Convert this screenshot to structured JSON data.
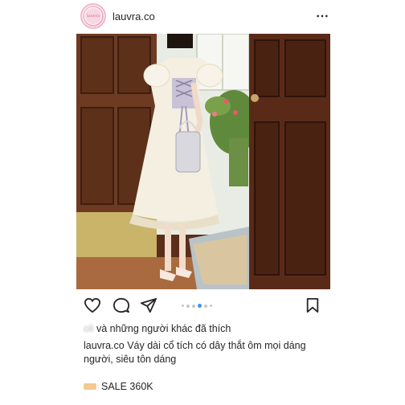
{
  "post": {
    "username": "lauvra.co",
    "avatar_text": "lauvra",
    "more_icon": "⋯",
    "likes": {
      "prefix_blurred": "oli     ",
      "text": "và những người khác đã thích"
    },
    "caption": {
      "username": "lauvra.co",
      "text": "Váy dài cổ tích có dây thắt ôm mọi dáng người, siêu tôn dáng"
    },
    "sale": "SALE 360K",
    "carousel": {
      "count": 6,
      "active_index": 3
    }
  },
  "colors": {
    "active_dot": "#3897f0",
    "inactive_dot": "#c7c7c7",
    "text": "#262626"
  },
  "icons": [
    "heart-icon",
    "comment-icon",
    "share-icon",
    "bookmark-icon"
  ]
}
